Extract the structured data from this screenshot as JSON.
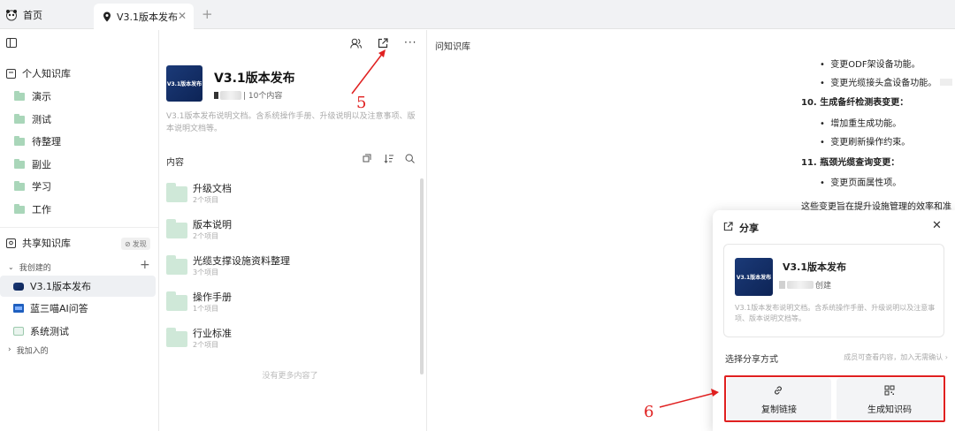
{
  "tabs": {
    "home": "首页",
    "active": "V3.1版本发布",
    "close": "✕",
    "add": "+"
  },
  "sidebar": {
    "personal_title": "个人知识库",
    "personal_items": [
      "演示",
      "测试",
      "待整理",
      "副业",
      "学习",
      "工作"
    ],
    "shared_title": "共享知识库",
    "discover": "发现",
    "created_by_me": "我创建的",
    "created_items": [
      "V3.1版本发布",
      "蓝三喵AI问答",
      "系统测试"
    ],
    "joined": "我加入的"
  },
  "kb": {
    "cover_text": "V3.1版本发布",
    "title": "V3.1版本发布",
    "meta": "| 10个内容",
    "desc": "V3.1版本发布说明文档。含系统操作手册、升级说明以及注意事项、版本说明文档等。",
    "content_label": "内容",
    "folders": [
      {
        "name": "升级文档",
        "count": "2个项目"
      },
      {
        "name": "版本说明",
        "count": "2个项目"
      },
      {
        "name": "光缆支撑设施资料整理",
        "count": "3个项目"
      },
      {
        "name": "操作手册",
        "count": "1个项目"
      },
      {
        "name": "行业标准",
        "count": "2个项目"
      }
    ],
    "no_more": "没有更多内容了"
  },
  "doc": {
    "header": "问知识库",
    "b1": "变更ODF架设备功能。",
    "b2": "变更光缆接头盒设备功能。",
    "h10": "10. 生成备纤检测表变更：",
    "b3": "增加重生成功能。",
    "b4": "变更刷新操作约束。",
    "h11": "11. 瓶颈光缆查询变更：",
    "b5": "变更页面属性项。",
    "summary": "这些变更旨在提升设施管理的效率和准"
  },
  "share": {
    "title": "分享",
    "close": "✕",
    "kb_title": "V3.1版本发布",
    "created": "创建",
    "desc": "V3.1版本发布说明文档。含系统操作手册、升级说明以及注意事项、版本说明文档等。",
    "choose_label": "选择分享方式",
    "choose_hint": "成员可查看内容，加入无需确认 ›",
    "copy_link": "复制链接",
    "gen_code": "生成知识码"
  },
  "annotations": {
    "five": "5",
    "six": "6"
  },
  "colors": {
    "annotation": "#e02020",
    "folder": "#cfe8d8",
    "cover": "#13306a"
  }
}
